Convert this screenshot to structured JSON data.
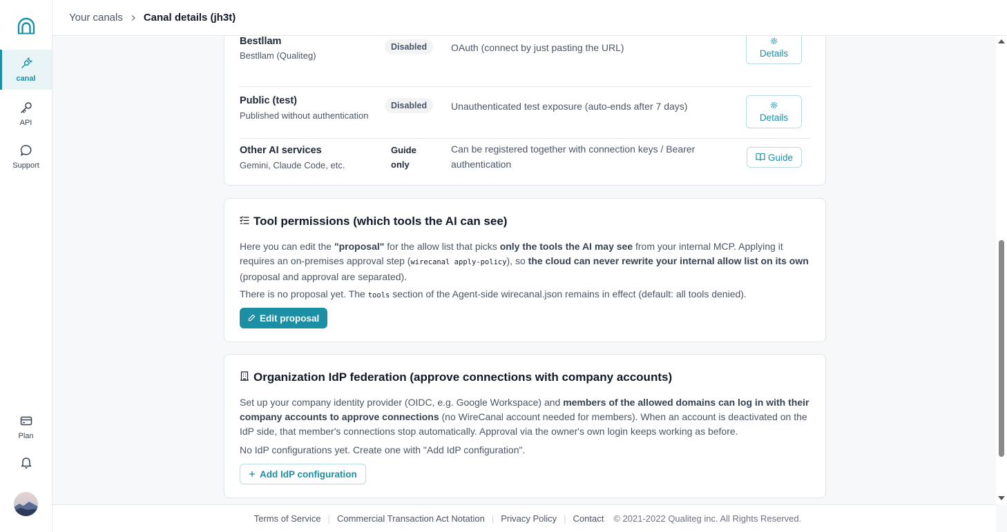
{
  "sidebar": {
    "items": [
      {
        "label": "canal",
        "icon": "plug-icon"
      },
      {
        "label": "API",
        "icon": "key-icon"
      },
      {
        "label": "Support",
        "icon": "chat-bubble-icon"
      }
    ],
    "bottom_items": [
      {
        "label": "Plan",
        "icon": "credit-card-icon"
      }
    ]
  },
  "header": {
    "breadcrumb_parent": "Your canals",
    "breadcrumb_current": "Canal details (jh3t)"
  },
  "connections": {
    "rows": [
      {
        "name": "Bestllam",
        "subtitle": "Bestllam (Qualiteg)",
        "status": "Disabled",
        "description": "OAuth (connect by just pasting the URL)",
        "action": "Details"
      },
      {
        "name": "Public (test)",
        "subtitle": "Published without authentication",
        "status": "Disabled",
        "description": "Unauthenticated test exposure (auto-ends after 7 days)",
        "action": "Details"
      },
      {
        "name": "Other AI services",
        "subtitle": "Gemini, Claude Code, etc.",
        "status": "Guide only",
        "description": "Can be registered together with connection keys / Bearer authentication",
        "action": "Guide"
      }
    ]
  },
  "tool_permissions": {
    "title": "Tool permissions (which tools the AI can see)",
    "p1_a": "Here you can edit the ",
    "p1_b": "\"proposal\"",
    "p1_c": " for the allow list that picks ",
    "p1_d": "only the tools the AI may see",
    "p1_e": " from your internal MCP. Applying it requires an on-premises approval step (",
    "p1_code": "wirecanal apply-policy",
    "p1_f": "), so ",
    "p1_g": "the cloud can never rewrite your internal allow list on its own",
    "p1_h": " (proposal and approval are separated).",
    "p2_a": "There is no proposal yet. The ",
    "p2_code": "tools",
    "p2_b": " section of the Agent-side wirecanal.json remains in effect (default: all tools denied).",
    "button": "Edit proposal"
  },
  "idp": {
    "title": "Organization IdP federation (approve connections with company accounts)",
    "p1_a": "Set up your company identity provider (OIDC, e.g. Google Workspace) and ",
    "p1_b": "members of the allowed domains can log in with their company accounts to approve connections",
    "p1_c": " (no WireCanal account needed for members). When an account is deactivated on the IdP side, that member's connections stop automatically. Approval via the owner's own login keeps working as before.",
    "p2": "No IdP configurations yet. Create one with \"Add IdP configuration\".",
    "button": "Add IdP configuration"
  },
  "footer": {
    "links": [
      "Terms of Service",
      "Commercial Transaction Act Notation",
      "Privacy Policy",
      "Contact"
    ],
    "copyright": "© 2021-2022 Qualiteg inc. All Rights Reserved."
  },
  "colors": {
    "accent": "#1b8fa3",
    "accent_light_bg": "#e9f4f6"
  }
}
